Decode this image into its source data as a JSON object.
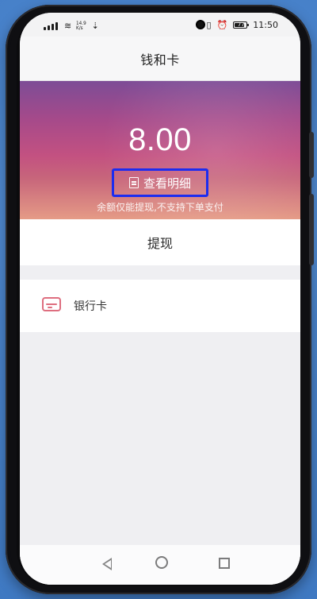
{
  "status_bar": {
    "speed_top": "14.9",
    "speed_bottom": "K/s",
    "time": "11:50",
    "battery_text": "77",
    "icons": [
      "signal-icon",
      "wifi-icon",
      "download-icon",
      "sim-icon",
      "alarm-icon",
      "battery-icon"
    ]
  },
  "page": {
    "title": "钱和卡"
  },
  "balance": {
    "amount": "8.00",
    "detail_label": "查看明细",
    "hint": "余额仅能提现,不支持下单支付"
  },
  "actions": {
    "withdraw": "提现"
  },
  "cards": {
    "bank_card": "银行卡"
  },
  "colors": {
    "highlight_box": "#1c2cf0",
    "card_icon": "#de6e7f"
  }
}
